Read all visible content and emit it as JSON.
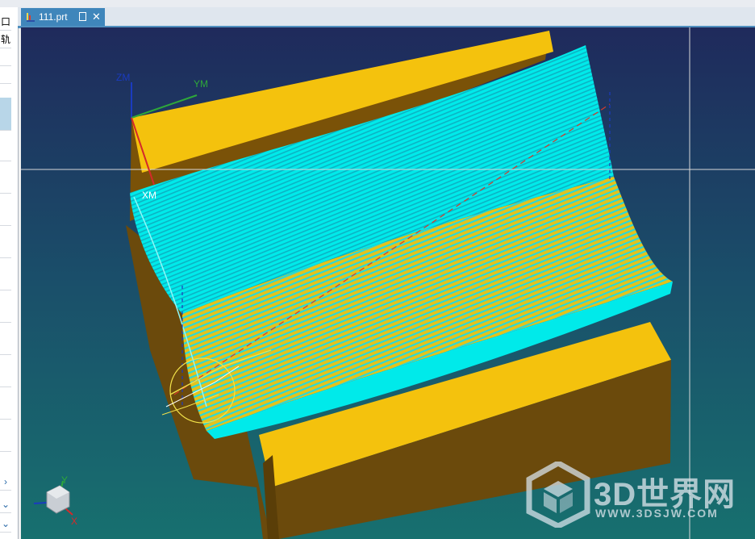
{
  "tab": {
    "label": "111.prt",
    "close_glyph": "✕",
    "icon": "part-file-icon"
  },
  "left_panel": {
    "top_char": "口",
    "label_char": "轨"
  },
  "axes": {
    "zm": "ZM",
    "ym": "YM",
    "xm": "XM",
    "x": "X",
    "y": "Y"
  },
  "watermark": {
    "text": "3D世界网",
    "url": "WWW.3DSJW.COM"
  },
  "colors": {
    "part": "#f4c20d",
    "part_side": "#6b4a0c",
    "toolpath": "#00f0ee",
    "tab_active": "#3f86bb",
    "bg_top": "#1f2a5c",
    "bg_bottom": "#17706f"
  }
}
